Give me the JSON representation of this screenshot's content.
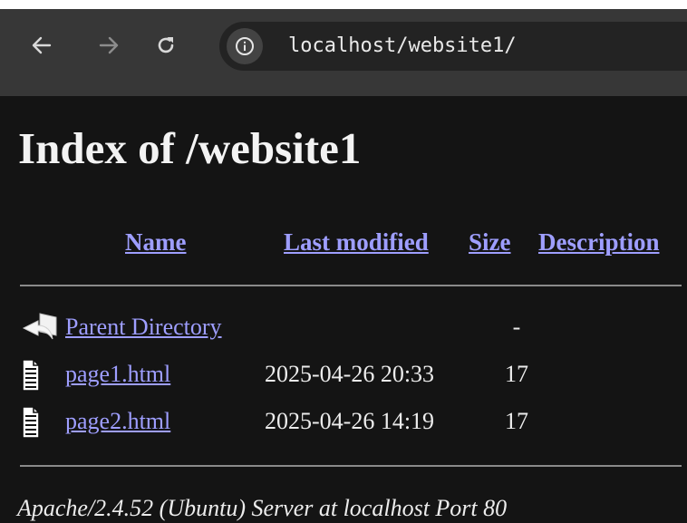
{
  "browser": {
    "back_icon": "arrow-left-icon",
    "forward_icon": "arrow-right-icon",
    "reload_icon": "reload-icon",
    "site_info_icon": "info-icon",
    "url": "localhost/website1/"
  },
  "page": {
    "title": "Index of /website1",
    "columns": {
      "name": "Name",
      "last_modified": "Last modified",
      "size": "Size",
      "description": "Description"
    },
    "rows": [
      {
        "icon": "back-folder-icon",
        "name": "Parent Directory",
        "modified": "",
        "size": "-"
      },
      {
        "icon": "text-file-icon",
        "name": "page1.html",
        "modified": "2025-04-26 20:33",
        "size": "17"
      },
      {
        "icon": "text-file-icon",
        "name": "page2.html",
        "modified": "2025-04-26 14:19",
        "size": "17"
      }
    ],
    "footer": "Apache/2.4.52 (Ubuntu) Server at localhost Port 80"
  },
  "colors": {
    "page_background": "#141414",
    "toolbar_background": "#373737",
    "omnibox_background": "#232323",
    "link": "#9e9eff",
    "text": "#ececec"
  }
}
